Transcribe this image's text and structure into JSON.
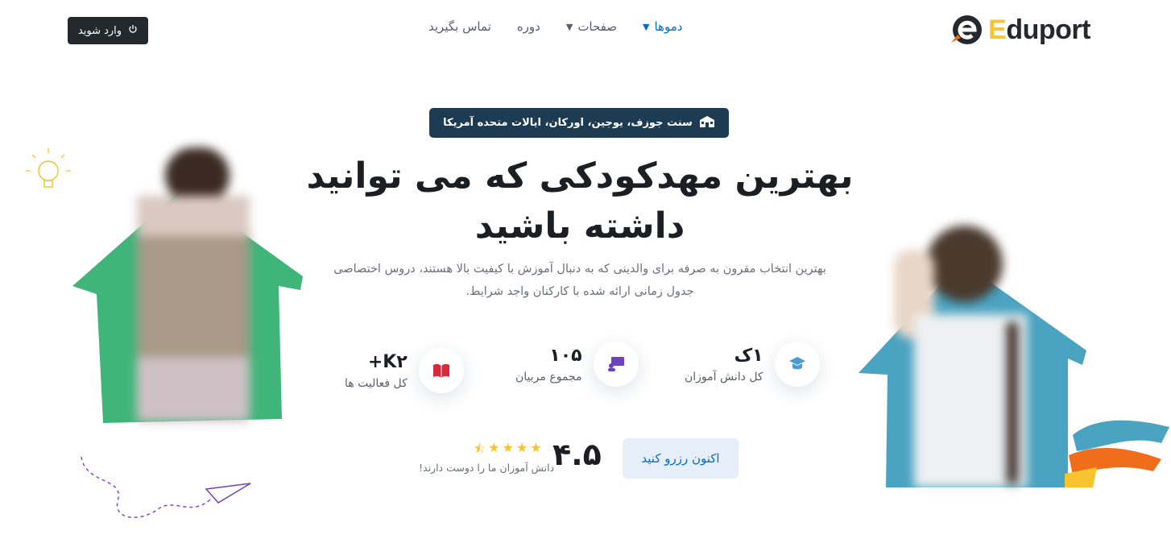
{
  "brand": {
    "name_first": "E",
    "name_rest": "duport",
    "accent": "#f7c32e",
    "dark": "#24292d"
  },
  "nav": {
    "items": [
      {
        "label": "دموها",
        "has_dropdown": true,
        "active": true
      },
      {
        "label": "صفحات",
        "has_dropdown": true,
        "active": false
      },
      {
        "label": "دوره",
        "has_dropdown": false,
        "active": false
      },
      {
        "label": "تماس بگیرید",
        "has_dropdown": false,
        "active": false
      }
    ],
    "login_label": "وارد شوید",
    "login_icon": "power-icon"
  },
  "hero": {
    "badge_icon": "school-building-icon",
    "badge_text": "سنت جوزف، یوجین، اورکان، ایالات متحده آمریکا",
    "title": "بهترین مهدکودکی که می توانید داشته باشید",
    "subtitle": "بهترین انتخاب مقرون به صرفه برای والدینی که به دنبال آموزش با کیفیت بالا هستند، دروس اختصاصی جدول زمانی ارائه شده با کارکنان واجد شرایط."
  },
  "stats": [
    {
      "value": "۱ک",
      "label": "کل دانش آموزان",
      "icon": "graduate-icon",
      "color": "#4c9bd6"
    },
    {
      "value": "۱۰۵",
      "label": "مجموع مربیان",
      "icon": "teacher-board-icon",
      "color": "#6f42c1"
    },
    {
      "value": "K۲+",
      "label": "کل فعالیت ها",
      "icon": "open-book-icon",
      "color": "#d6293e"
    }
  ],
  "cta": {
    "label": "اکنون رزرو کنید"
  },
  "rating": {
    "value": "۴.۵",
    "stars": 4.5,
    "caption": "دانش آموزان ما را دوست دارند!"
  },
  "colors": {
    "green_house": "#3fb57a",
    "blue_house": "#4aa3c0",
    "badge_bg": "#1d3b53",
    "link_blue": "#066ac9"
  }
}
